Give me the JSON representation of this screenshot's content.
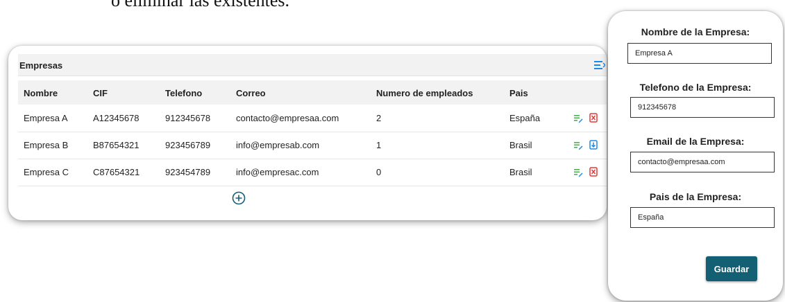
{
  "doc_text": "ó eliminar las existentes.",
  "table": {
    "title": "Empresas",
    "columns": [
      "Nombre",
      "CIF",
      "Telefono",
      "Correo",
      "Numero de empleados",
      "Pais"
    ],
    "rows": [
      {
        "nombre": "Empresa A",
        "cif": "A12345678",
        "telefono": "912345678",
        "correo": "contacto@empresaa.com",
        "empleados": "2",
        "pais": "España"
      },
      {
        "nombre": "Empresa B",
        "cif": "B87654321",
        "telefono": "923456789",
        "correo": "info@empresab.com",
        "empleados": "1",
        "pais": "Brasil"
      },
      {
        "nombre": "Empresa C",
        "cif": "C87654321",
        "telefono": "923454789",
        "correo": "info@empresac.com",
        "empleados": "0",
        "pais": "Brasil"
      }
    ],
    "icons": {
      "edit": "edit-icon",
      "delete": "delete-icon",
      "add": "add-circle-icon",
      "menu": "menu-icon"
    }
  },
  "form": {
    "name_label": "Nombre de la Empresa:",
    "name_value": "Empresa A",
    "phone_label": "Telefono de la Empresa:",
    "phone_value": "912345678",
    "email_label": "Email de la Empresa:",
    "email_value": "contacto@empresaa.com",
    "country_label": "Pais de la Empresa:",
    "country_value": "España",
    "save_label": "Guardar"
  },
  "colors": {
    "accent_blue": "#1e88e5",
    "edit_green": "#4caf50",
    "delete_red": "#e53935",
    "save_button": "#135f73"
  }
}
